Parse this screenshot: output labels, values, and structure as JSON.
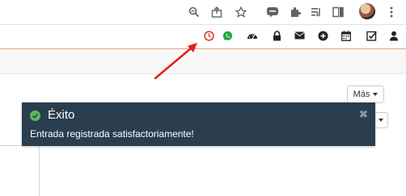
{
  "browser": {
    "toolbar_icons": [
      "zoom-icon",
      "share-icon",
      "bookmark-star-icon",
      "extension-icon",
      "puzzle-icon",
      "reading-list-icon",
      "side-panel-icon",
      "profile-avatar",
      "kebab-menu-icon"
    ]
  },
  "app_nav": {
    "icons": [
      "clock-icon",
      "whatsapp-icon",
      "dashboard-icon",
      "lock-icon",
      "envelope-icon",
      "plus-circle-icon",
      "calendar-icon",
      "checkbox-icon",
      "user-icon"
    ],
    "colors": {
      "clock": "#d9302a",
      "whatsapp": "#25a844",
      "nav_icon": "#222222",
      "accent_line": "#e0a56c"
    }
  },
  "toolbar": {
    "mas_label": "Más"
  },
  "toast": {
    "title": "Éxito",
    "message": "Entrada registrada satisfactoriamente!",
    "close_glyph": "✖",
    "colors": {
      "background": "#2b3e4e",
      "check": "#5cb85c"
    }
  },
  "annotation": {
    "arrow_color": "#e0201c"
  }
}
